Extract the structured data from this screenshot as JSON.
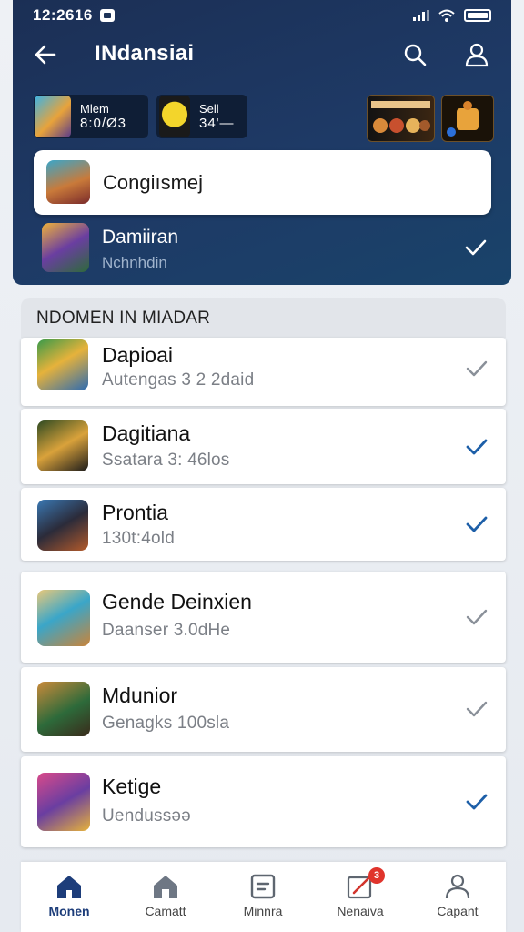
{
  "status_bar": {
    "time": "12:2616"
  },
  "header": {
    "title": "INdansiai",
    "chips": [
      {
        "line1": "Mlem",
        "line2": "8:0/Ø3"
      },
      {
        "line1": "Sell",
        "line2": "34'—"
      }
    ]
  },
  "search": {
    "value": "Congiısmej"
  },
  "featured": {
    "title": "Damiiran",
    "subtitle": "Nchnhdin"
  },
  "section": {
    "title": "NDOMEN IN MIADAR"
  },
  "items": [
    {
      "title": "Dapioai",
      "subtitle": "Autengas 3 2 2daid",
      "checked": false
    },
    {
      "title": "Dagitiana",
      "subtitle": "Ssatara 3: 46los",
      "checked": true
    },
    {
      "title": "Prontia",
      "subtitle": "130t:4old",
      "checked": true
    },
    {
      "title": "Gende Deinxien",
      "subtitle": "Daanser 3.0dHe",
      "checked": false
    },
    {
      "title": "Mdunior",
      "subtitle": "Genagks 100sla",
      "checked": false
    },
    {
      "title": "Ketige",
      "subtitle": "Uendussəə",
      "checked": true
    }
  ],
  "bottom_nav": {
    "tabs": [
      {
        "label": "Monen",
        "icon": "home-icon"
      },
      {
        "label": "Camatt",
        "icon": "store-icon"
      },
      {
        "label": "Minnra",
        "icon": "document-icon"
      },
      {
        "label": "Nenaiva",
        "icon": "edit-icon",
        "badge": "3"
      },
      {
        "label": "Capant",
        "icon": "profile-icon"
      }
    ]
  },
  "colors": {
    "header_bg": "#1e3a66",
    "accent": "#1d5fa8",
    "check_inactive": "#8a9099"
  }
}
